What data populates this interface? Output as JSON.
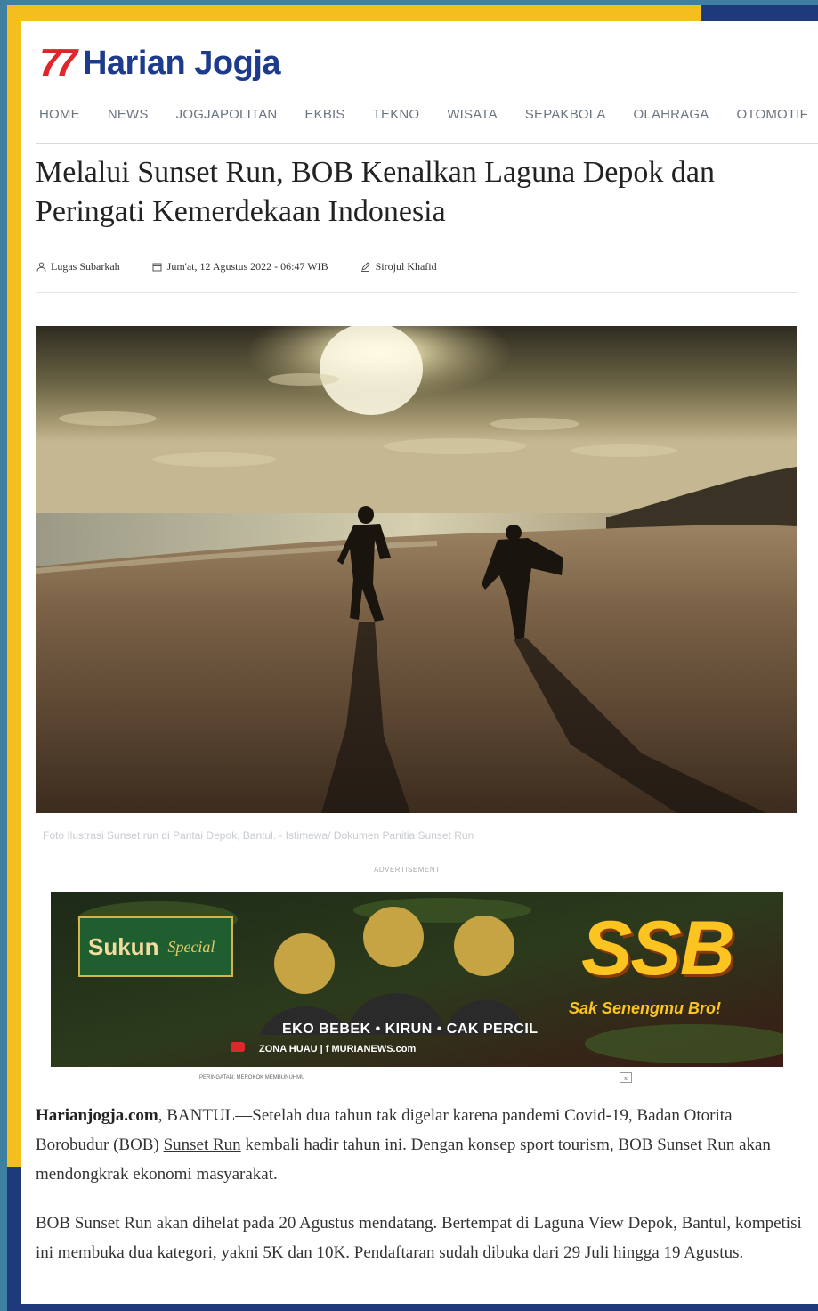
{
  "site": {
    "logo_mark": "77",
    "logo_text": "Harian Jogja"
  },
  "nav": {
    "items": [
      "HOME",
      "NEWS",
      "JOGJAPOLITAN",
      "EKBIS",
      "TEKNO",
      "WISATA",
      "SEPAKBOLA",
      "OLAHRAGA",
      "OTOMOTIF"
    ]
  },
  "article": {
    "title": "Melalui Sunset Run, BOB Kenalkan Laguna Depok dan Peringati Kemerdekaan Indonesia",
    "author": "Lugas Subarkah",
    "date": "Jum'at, 12 Agustus 2022 - 06:47 WIB",
    "editor": "Sirojul Khafid",
    "photo_caption": "Foto Ilustrasi Sunset run di Pantai Depok, Bantul. - Istimewa/ Dokumen Panitia Sunset Run",
    "p1_source": "Harianjogja.com",
    "p1_before_link": ", BANTUL—Setelah dua tahun tak digelar karena pandemi Covid-19, Badan Otorita Borobudur (BOB) ",
    "p1_link": "Sunset Run",
    "p1_after_link": " kembali hadir tahun ini. Dengan konsep sport tourism, BOB Sunset Run akan mendongkrak ekonomi masyarakat.",
    "p2": "BOB Sunset Run akan dihelat pada 20 Agustus mendatang. Bertempat di Laguna View Depok, Bantul, kompetisi ini membuka dua kategori, yakni 5K dan 10K. Pendaftaran sudah dibuka dari 29 Juli hingga 19 Agustus."
  },
  "ad": {
    "label": "ADVERTISEMENT",
    "brand_line1": "Sukun",
    "brand_line2": "Special",
    "title": "SSB",
    "tagline": "Sak Senengmu Bro!",
    "cast": "EKO BEBEK • KIRUN • CAK PERCIL",
    "channel": "ZONA HUAU | f MURIANEWS.com",
    "disclaimer": "PERINGATAN: MEROKOK MEMBUNUHMU",
    "close": "x"
  },
  "colors": {
    "frame_yellow": "#f5be1f",
    "frame_blue": "#1e3a7b",
    "logo_red": "#e0252b",
    "logo_blue": "#1d3b8c"
  }
}
